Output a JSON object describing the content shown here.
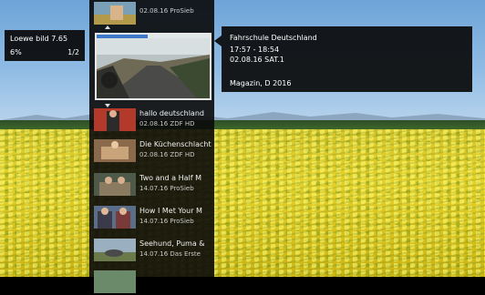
{
  "device_info": {
    "name": "Loewe bild 7.65",
    "percent": "6%",
    "page": "1/2"
  },
  "selected_program": {
    "title": "Fahrschule Deutschland",
    "time": "17:57 - 18:54",
    "date_channel": "02.08.16  SAT.1",
    "magazine": "Magazin, D 2016",
    "progress": 0.45
  },
  "program_list": [
    {
      "title": "",
      "subtitle": "02.08.16 ProSieb"
    },
    {
      "title": "hallo deutschland",
      "subtitle": "02.08.16 ZDF HD"
    },
    {
      "title": "Die Küchenschlacht",
      "subtitle": "02.08.16 ZDF HD"
    },
    {
      "title": "Two and a Half M",
      "subtitle": "14.07.16 ProSieb"
    },
    {
      "title": "How I Met Your M",
      "subtitle": "14.07.16 ProSieb"
    },
    {
      "title": "Seehund, Puma &",
      "subtitle": "14.07.16 Das Erste"
    }
  ],
  "colors": {
    "panel": "#0a0a0a",
    "accent": "#3e78c8",
    "border": "#e8e8e8"
  }
}
